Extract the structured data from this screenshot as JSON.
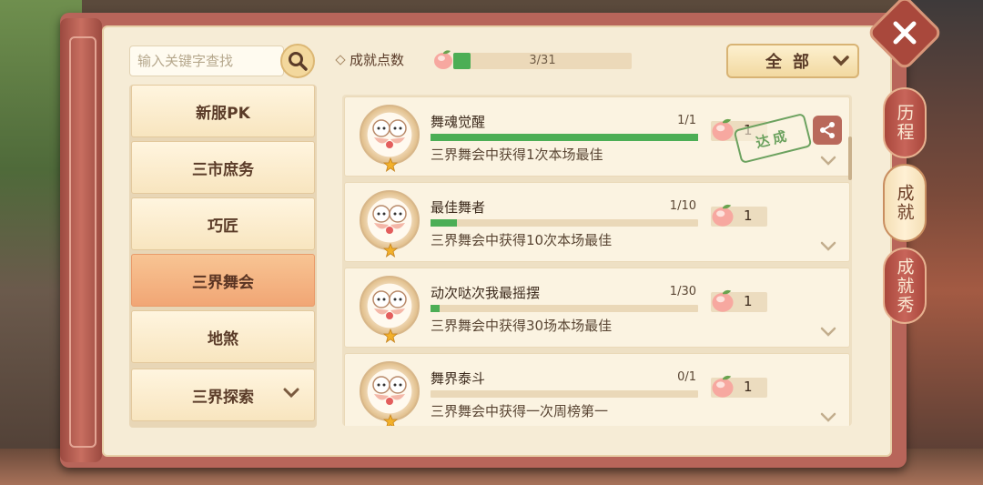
{
  "search": {
    "placeholder": "输入关键字查找"
  },
  "categories": [
    {
      "label": "新服PK"
    },
    {
      "label": "三市庶务"
    },
    {
      "label": "巧匠"
    },
    {
      "label": "三界舞会"
    },
    {
      "label": "地煞"
    },
    {
      "label": "三界探索"
    }
  ],
  "points": {
    "label": "成就点数",
    "value": "3/31",
    "fraction": 0.097
  },
  "filter": {
    "label": "全部"
  },
  "achievements": [
    {
      "title": "舞魂觉醒",
      "count": "1/1",
      "progress": 1.0,
      "desc": "三界舞会中获得1次本场最佳",
      "reward": "1",
      "stamp": "达成"
    },
    {
      "title": "最佳舞者",
      "count": "1/10",
      "progress": 0.1,
      "desc": "三界舞会中获得10次本场最佳",
      "reward": "1"
    },
    {
      "title": "动次哒次我最摇摆",
      "count": "1/30",
      "progress": 0.033,
      "desc": "三界舞会中获得30场本场最佳",
      "reward": "1"
    },
    {
      "title": "舞界泰斗",
      "count": "0/1",
      "progress": 0.0,
      "desc": "三界舞会中获得一次周榜第一",
      "reward": "1"
    }
  ],
  "side_tabs": [
    {
      "label": "历程"
    },
    {
      "label": "成就"
    },
    {
      "label": "成就秀"
    }
  ],
  "colors": {
    "progress": "#4cae55",
    "active_category": "#f4b07f",
    "frame": "#b8655a"
  }
}
